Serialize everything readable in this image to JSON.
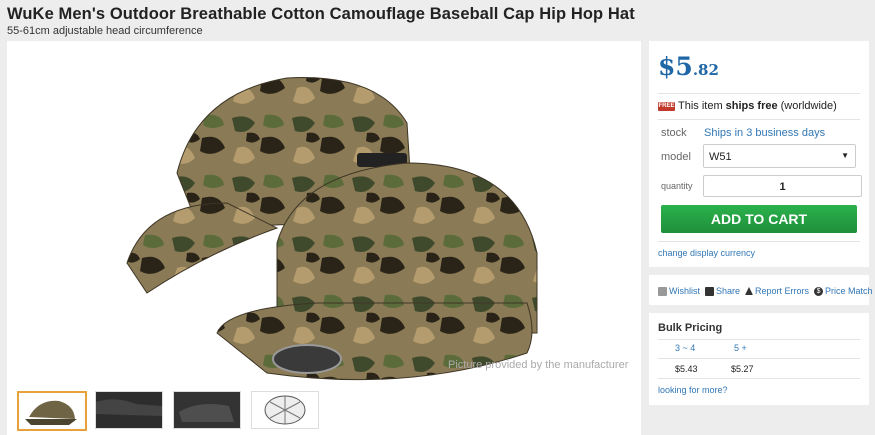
{
  "product": {
    "title": "WuKe Men's Outdoor Breathable Cotton Camouflage Baseball Cap Hip Hop Hat",
    "subtitle": "55-61cm adjustable head circumference",
    "image_caption": "Picture provided by the manufacturer",
    "thumbnails": [
      "thumb-1",
      "thumb-2",
      "thumb-3",
      "thumb-4"
    ]
  },
  "price": {
    "currency": "$",
    "whole": "5",
    "cents": ".82"
  },
  "shipping": {
    "icon_text": "FREE",
    "prefix": "This item ",
    "bold": "ships free",
    "suffix": " (worldwide)"
  },
  "stock": {
    "label": "stock",
    "value": "Ships in 3 business days"
  },
  "model": {
    "label": "model",
    "selected": "W51"
  },
  "quantity": {
    "label": "quantity",
    "value": "1"
  },
  "cart": {
    "button": "ADD TO CART"
  },
  "currency_link": "change display currency",
  "actions": {
    "wishlist": "Wishlist",
    "share": "Share",
    "report": "Report Errors",
    "price_match": "Price Match"
  },
  "bulk": {
    "title": "Bulk Pricing",
    "headers": [
      "3 ~ 4",
      "5 +"
    ],
    "prices": [
      "$5.43",
      "$5.27"
    ],
    "more": "looking for more?"
  },
  "colors": {
    "price": "#1f66a6",
    "link": "#3277b5",
    "cart_button": "#22a244"
  },
  "icons": [
    "free-shipping-icon",
    "wishlist-icon",
    "share-icon",
    "report-errors-icon",
    "price-match-icon",
    "dropdown-arrow-icon"
  ]
}
